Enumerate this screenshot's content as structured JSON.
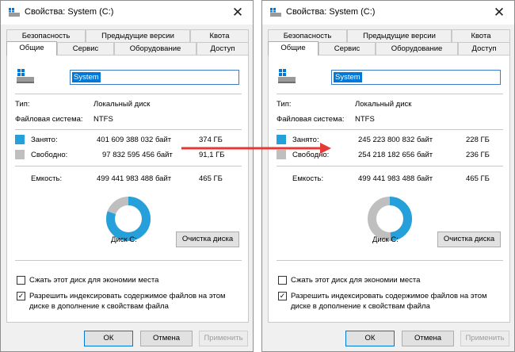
{
  "colors": {
    "used": "#26a0da",
    "free": "#bfbfbf",
    "arrow": "#e53935",
    "accent": "#0078d7"
  },
  "icons": {
    "title": "drive-icon",
    "close": "close-icon",
    "drive": "drive-icon",
    "arrow": "arrow-right-icon"
  },
  "dialogs": [
    {
      "title": "Свойства: System (C:)",
      "close": "✕",
      "tabs_back": [
        "Безопасность",
        "Предыдущие версии",
        "Квота"
      ],
      "tabs_front": [
        "Общие",
        "Сервис",
        "Оборудование",
        "Доступ"
      ],
      "drive_name": "System",
      "type_label": "Тип:",
      "type_value": "Локальный диск",
      "fs_label": "Файловая система:",
      "fs_value": "NTFS",
      "used_label": "Занято:",
      "used_bytes": "401 609 388 032 байт",
      "used_size": "374 ГБ",
      "free_label": "Свободно:",
      "free_bytes": "97 832 595 456 байт",
      "free_size": "91,1 ГБ",
      "capacity_label": "Емкость:",
      "capacity_bytes": "499 441 983 488 байт",
      "capacity_size": "465 ГБ",
      "used_fraction": 0.804,
      "disk_label": "Диск C:",
      "cleanup_button": "Очистка диска",
      "compress_label": "Сжать этот диск для экономии места",
      "compress_checked": false,
      "index_label_line1": "Разрешить индексировать содержимое файлов на этом",
      "index_label_line2": "диске в дополнение к свойствам файла",
      "index_checked": true,
      "ok_button": "ОК",
      "cancel_button": "Отмена",
      "apply_button": "Применить"
    },
    {
      "title": "Свойства: System (C:)",
      "close": "✕",
      "tabs_back": [
        "Безопасность",
        "Предыдущие версии",
        "Квота"
      ],
      "tabs_front": [
        "Общие",
        "Сервис",
        "Оборудование",
        "Доступ"
      ],
      "drive_name": "System",
      "type_label": "Тип:",
      "type_value": "Локальный диск",
      "fs_label": "Файловая система:",
      "fs_value": "NTFS",
      "used_label": "Занято:",
      "used_bytes": "245 223 800 832 байт",
      "used_size": "228 ГБ",
      "free_label": "Свободно:",
      "free_bytes": "254 218 182 656 байт",
      "free_size": "236 ГБ",
      "capacity_label": "Емкость:",
      "capacity_bytes": "499 441 983 488 байт",
      "capacity_size": "465 ГБ",
      "used_fraction": 0.491,
      "disk_label": "Диск C:",
      "cleanup_button": "Очистка диска",
      "compress_label": "Сжать этот диск для экономии места",
      "compress_checked": false,
      "index_label_line1": "Разрешить индексировать содержимое файлов на этом",
      "index_label_line2": "диске в дополнение к свойствам файла",
      "index_checked": true,
      "ok_button": "ОК",
      "cancel_button": "Отмена",
      "apply_button": "Применить"
    }
  ]
}
